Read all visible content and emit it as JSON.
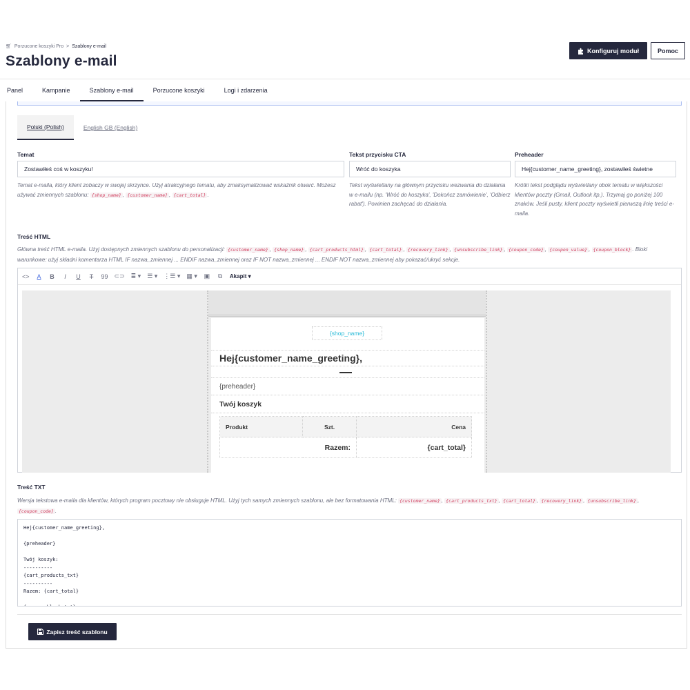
{
  "header": {
    "breadcrumb": {
      "parent": "Porzucone koszyki Pro",
      "separator": ">",
      "current": "Szablony e-mail"
    },
    "title": "Szablony e-mail",
    "configure_label": "Konfiguruj moduł",
    "help_label": "Pomoc"
  },
  "tabs": [
    "Panel",
    "Kampanie",
    "Szablony e-mail",
    "Porzucone koszyki",
    "Logi i zdarzenia"
  ],
  "active_tab": "Szablony e-mail",
  "language_tabs": {
    "polish": "Polski (Polish)",
    "english": "English GB (English)"
  },
  "fields": {
    "subject": {
      "label": "Temat",
      "value": "Zostawiłeś coś w koszyku!",
      "help_text": "Temat e-maila, który klient zobaczy w swojej skrzynce. Użyj atrakcyjnego tematu, aby zmaksymalizować wskaźnik otwarć. Możesz używać zmiennych szablonu:",
      "vars": [
        "{shop_name}",
        "{customer_name}",
        "{cart_total}"
      ]
    },
    "cta": {
      "label": "Tekst przycisku CTA",
      "value": "Wróć do koszyka",
      "help_text": "Tekst wyświetlany na głównym przycisku wezwania do działania w e-mailu (np. 'Wróć do koszyka', 'Dokończ zamówienie', 'Odbierz rabat'). Powinien zachęcać do działania."
    },
    "preheader": {
      "label": "Preheader",
      "value": "Hej{customer_name_greeting}, zostawiłeś świetne",
      "help_text": "Krótki tekst podglądu wyświetlany obok tematu w większości klientów poczty (Gmail, Outlook itp.). Trzymaj go poniżej 100 znaków. Jeśli pusty, klient poczty wyświetli pierwszą linię treści e-maila."
    }
  },
  "html_content": {
    "label": "Treść HTML",
    "help_prefix": "Główna treść HTML e-maila. Użyj dostępnych zmiennych szablonu do personalizacji:",
    "vars": [
      "{customer_name}",
      "{shop_name}",
      "{cart_products_html}",
      "{cart_total}",
      "{recovery_link}",
      "{unsubscribe_link}",
      "{coupon_code}",
      "{coupon_value}",
      "{coupon_block}"
    ],
    "help_suffix": ". Bloki warunkowe: użyj składni komentarza HTML IF nazwa_zmiennej ... ENDIF nazwa_zmiennej oraz IF NOT nazwa_zmiennej ... ENDIF NOT nazwa_zmiennej aby pokazać/ukryć sekcje.",
    "toolbar": {
      "paragraph_label": "Akapit"
    },
    "preview": {
      "shop_name": "{shop_name}",
      "greeting": "Hej{customer_name_greeting},",
      "preheader": "{preheader}",
      "cart_title": "Twój koszyk",
      "table_headers": {
        "product": "Produkt",
        "qty": "Szt.",
        "price": "Cena"
      },
      "total_label": "Razem:",
      "total_value": "{cart_total}"
    }
  },
  "txt_content": {
    "label": "Treść TXT",
    "help_prefix": "Wersja tekstowa e-maila dla klientów, których program pocztowy nie obsługuje HTML. Użyj tych samych zmiennych szablonu, ale bez formatowania HTML:",
    "vars": [
      "{customer_name}",
      "{cart_products_txt}",
      "{cart_total}",
      "{recovery_link}",
      "{unsubscribe_link}",
      "{coupon_code}"
    ],
    "value": "Hej{customer_name_greeting},\n\n{preheader}\n\nTwój koszyk:\n----------\n{cart_products_txt}\n----------\nRazem: {cart_total}\n\n{coupon_block_txt}"
  },
  "save_label": "Zapisz treść szablonu"
}
